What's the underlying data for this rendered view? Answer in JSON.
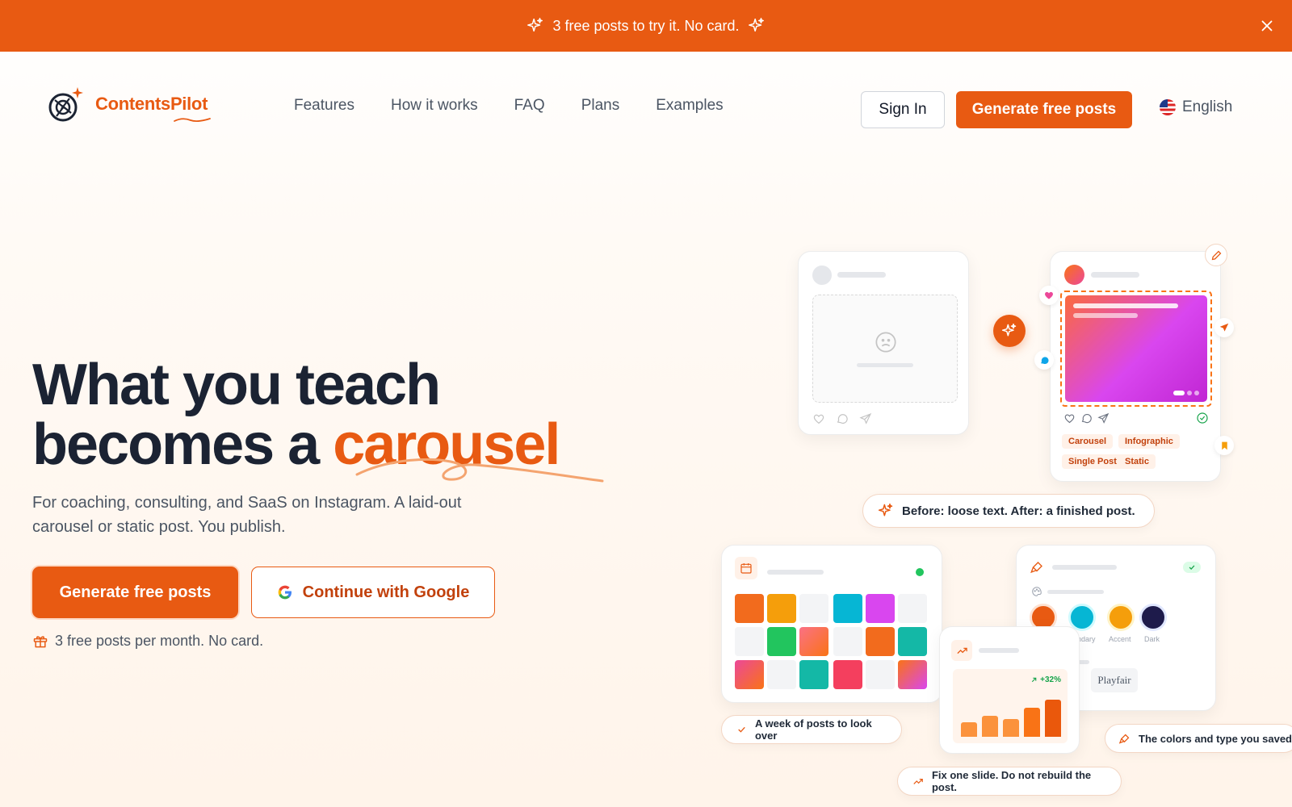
{
  "announcement": {
    "text": "3 free posts to try it. No card."
  },
  "header": {
    "logo": {
      "part1": "Contents",
      "part2": "Pilot"
    },
    "nav": [
      "Features",
      "How it works",
      "FAQ",
      "Plans",
      "Examples"
    ],
    "sign_in": "Sign In",
    "generate": "Generate free posts",
    "language": "English"
  },
  "hero": {
    "title_line1": "What you teach",
    "title_line2_prefix": "becomes a ",
    "title_accent": "carousel",
    "subtitle": "For coaching, consulting, and SaaS on Instagram. A laid-out carousel or static post. You publish.",
    "cta_primary": "Generate free posts",
    "cta_google": "Continue with Google",
    "free_note": "3 free posts per month. No card."
  },
  "illustration": {
    "tags": [
      "Carousel",
      "Infographic",
      "Single Post",
      "Static"
    ],
    "before_after": "Before: loose text. After: a finished post.",
    "week_label": "A week of posts to look over",
    "fix_label": "Fix one slide. Do not rebuild the post.",
    "brand_label": "The colors and type you saved",
    "growth": "+32%",
    "swatch_labels": [
      "ondary",
      "Accent",
      "Dark"
    ],
    "font_sample": "Playfair"
  },
  "colors": {
    "brand": "#e85a12",
    "text": "#1b2333"
  }
}
